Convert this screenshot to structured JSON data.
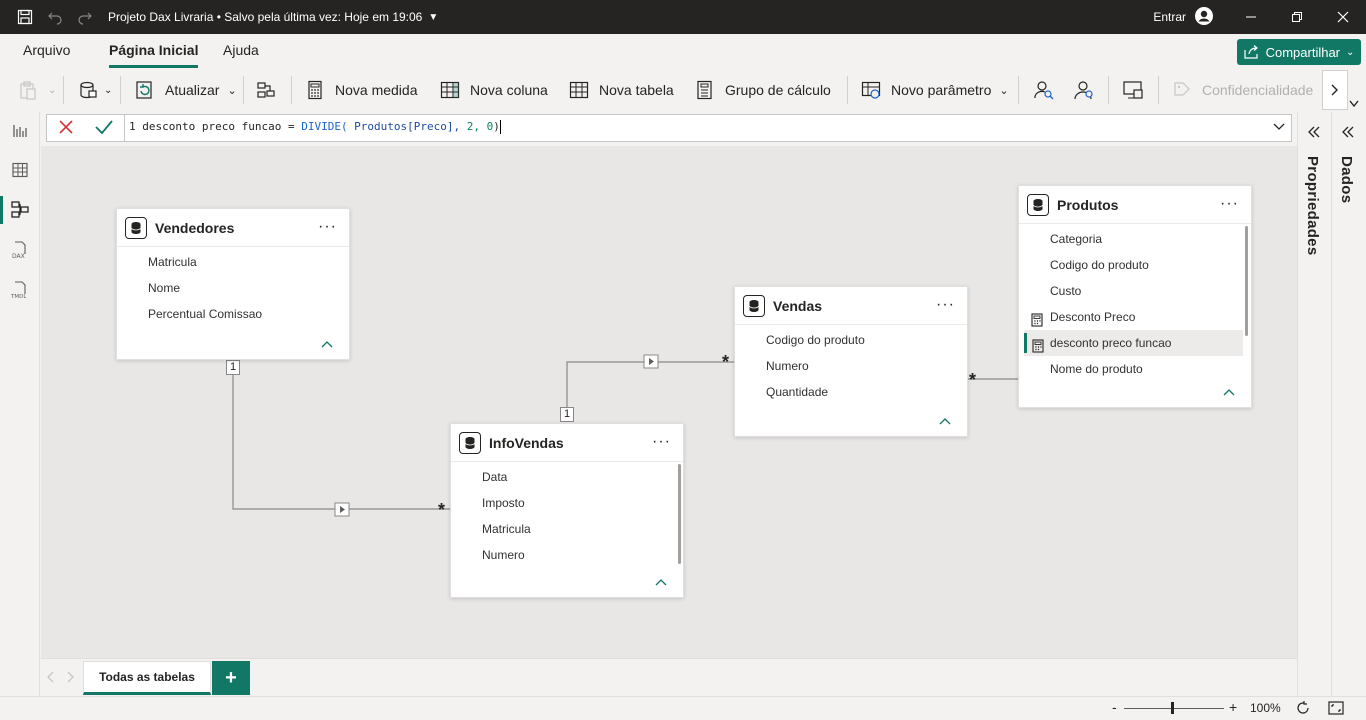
{
  "titlebar": {
    "document_title": "Projeto Dax Livraria • Salvo pela última vez: Hoje em 19:06",
    "signin_label": "Entrar"
  },
  "menu": {
    "tabs": [
      "Arquivo",
      "Página Inicial",
      "Ajuda"
    ],
    "share_label": "Compartilhar"
  },
  "ribbon": {
    "refresh": "Atualizar",
    "new_measure": "Nova medida",
    "new_column": "Nova coluna",
    "new_table": "Nova tabela",
    "calc_group": "Grupo de cálculo",
    "new_parameter": "Novo parâmetro",
    "sensitivity": "Confidencialidade"
  },
  "formula": {
    "line_number": "1",
    "lhs": "desconto preco funcao = ",
    "function": "DIVIDE(",
    "reference": " Produtos[Preco],",
    "arg2": " 2,",
    "arg3": " 0",
    "close": ")"
  },
  "tables": {
    "vendedores": {
      "title": "Vendedores",
      "fields": [
        "Matricula",
        "Nome",
        "Percentual Comissao"
      ]
    },
    "vendas": {
      "title": "Vendas",
      "fields": [
        "Codigo do produto",
        "Numero",
        "Quantidade"
      ]
    },
    "infovendas": {
      "title": "InfoVendas",
      "fields": [
        "Data",
        "Imposto",
        "Matricula",
        "Numero"
      ]
    },
    "produtos": {
      "title": "Produtos",
      "fields": [
        "Categoria",
        "Codigo do produto",
        "Custo",
        "Desconto Preco",
        "desconto preco funcao",
        "Nome do produto"
      ]
    }
  },
  "relationships": {
    "one_label": "1",
    "many_label": "*"
  },
  "panes": {
    "properties": "Propriedades",
    "data": "Dados"
  },
  "page_tabs": {
    "all_tables": "Todas as tabelas",
    "add": "+"
  },
  "status": {
    "zoom": "100%"
  },
  "colors": {
    "accent": "#117865",
    "titlebar": "#252423"
  }
}
